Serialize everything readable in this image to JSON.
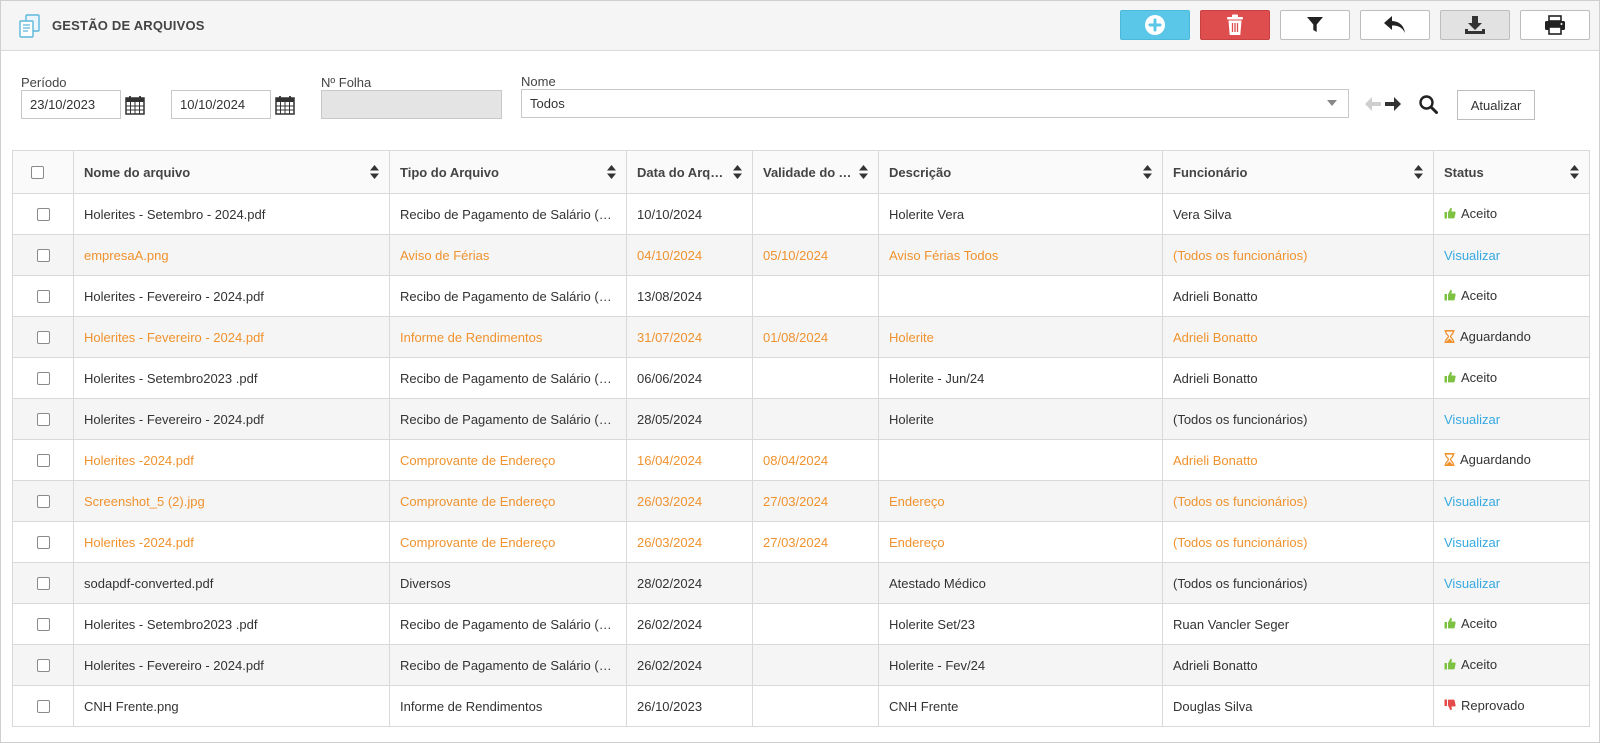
{
  "header": {
    "title": "GESTÃO DE ARQUIVOS",
    "toolbar": [
      "plus-circle-icon",
      "trash-icon",
      "filter-icon",
      "undo-arrow-icon",
      "download-icon",
      "printer-icon"
    ],
    "colors": {
      "add": "#5bc7e8",
      "delete": "#de4e4e"
    }
  },
  "filters": {
    "periodo_label": "Período",
    "date_from": "23/10/2023",
    "date_to": "10/10/2024",
    "folha_label": "Nº Folha",
    "folha_value": "",
    "nome_label": "Nome",
    "nome_value": "Todos",
    "atualizar_label": "Atualizar"
  },
  "table": {
    "columns": [
      "Nome do arquivo",
      "Tipo do Arquivo",
      "Data do Arquivo",
      "Validade do Arquivo",
      "Descrição",
      "Funcionário",
      "Status"
    ],
    "rows": [
      {
        "nome": "Holerites - Setembro - 2024.pdf",
        "tipo": "Recibo de Pagamento de Salário (Holerite)",
        "data": "10/10/2024",
        "validade": "",
        "descricao": "Holerite Vera",
        "funcionario": "Vera Silva",
        "status": "Aceito",
        "status_type": "accepted",
        "highlight": false
      },
      {
        "nome": "empresaA.png",
        "tipo": "Aviso de Férias",
        "data": "04/10/2024",
        "validade": "05/10/2024",
        "descricao": "Aviso Férias Todos",
        "funcionario": "(Todos os funcionários)",
        "status": "Visualizar",
        "status_type": "link",
        "highlight": true
      },
      {
        "nome": "Holerites - Fevereiro - 2024.pdf",
        "tipo": "Recibo de Pagamento de Salário (Holerite)",
        "data": "13/08/2024",
        "validade": "",
        "descricao": "",
        "funcionario": "Adrieli Bonatto",
        "status": "Aceito",
        "status_type": "accepted",
        "highlight": false
      },
      {
        "nome": "Holerites - Fevereiro - 2024.pdf",
        "tipo": "Informe de Rendimentos",
        "data": "31/07/2024",
        "validade": "01/08/2024",
        "descricao": "Holerite",
        "funcionario": "Adrieli Bonatto",
        "status": "Aguardando",
        "status_type": "waiting",
        "highlight": true
      },
      {
        "nome": "Holerites - Setembro2023 .pdf",
        "tipo": "Recibo de Pagamento de Salário (Holerite)",
        "data": "06/06/2024",
        "validade": "",
        "descricao": "Holerite - Jun/24",
        "funcionario": "Adrieli Bonatto",
        "status": "Aceito",
        "status_type": "accepted",
        "highlight": false
      },
      {
        "nome": "Holerites - Fevereiro - 2024.pdf",
        "tipo": "Recibo de Pagamento de Salário (Holerite)",
        "data": "28/05/2024",
        "validade": "",
        "descricao": "Holerite",
        "funcionario": "(Todos os funcionários)",
        "status": "Visualizar",
        "status_type": "link",
        "highlight": false
      },
      {
        "nome": "Holerites -2024.pdf",
        "tipo": "Comprovante de Endereço",
        "data": "16/04/2024",
        "validade": "08/04/2024",
        "descricao": "",
        "funcionario": "Adrieli Bonatto",
        "status": "Aguardando",
        "status_type": "waiting",
        "highlight": true
      },
      {
        "nome": "Screenshot_5 (2).jpg",
        "tipo": "Comprovante de Endereço",
        "data": "26/03/2024",
        "validade": "27/03/2024",
        "descricao": "Endereço",
        "funcionario": "(Todos os funcionários)",
        "status": "Visualizar",
        "status_type": "link",
        "highlight": true
      },
      {
        "nome": "Holerites -2024.pdf",
        "tipo": "Comprovante de Endereço",
        "data": "26/03/2024",
        "validade": "27/03/2024",
        "descricao": "Endereço",
        "funcionario": "(Todos os funcionários)",
        "status": "Visualizar",
        "status_type": "link",
        "highlight": true
      },
      {
        "nome": "sodapdf-converted.pdf",
        "tipo": "Diversos",
        "data": "28/02/2024",
        "validade": "",
        "descricao": "Atestado Médico",
        "funcionario": "(Todos os funcionários)",
        "status": "Visualizar",
        "status_type": "link",
        "highlight": false
      },
      {
        "nome": "Holerites - Setembro2023 .pdf",
        "tipo": "Recibo de Pagamento de Salário (Holerite)",
        "data": "26/02/2024",
        "validade": "",
        "descricao": "Holerite Set/23",
        "funcionario": "Ruan Vancler Seger",
        "status": "Aceito",
        "status_type": "accepted",
        "highlight": false
      },
      {
        "nome": "Holerites - Fevereiro - 2024.pdf",
        "tipo": "Recibo de Pagamento de Salário (Holerite)",
        "data": "26/02/2024",
        "validade": "",
        "descricao": "Holerite - Fev/24",
        "funcionario": "Adrieli Bonatto",
        "status": "Aceito",
        "status_type": "accepted",
        "highlight": false
      },
      {
        "nome": "CNH Frente.png",
        "tipo": "Informe de Rendimentos",
        "data": "26/10/2023",
        "validade": "",
        "descricao": "CNH Frente",
        "funcionario": "Douglas Silva",
        "status": "Reprovado",
        "status_type": "rejected",
        "highlight": false
      }
    ],
    "colors": {
      "highlight": "#f0922e",
      "link": "#36a9e1",
      "accepted": "#7dc242",
      "waiting": "#f0922e",
      "rejected": "#e64b4b"
    }
  }
}
